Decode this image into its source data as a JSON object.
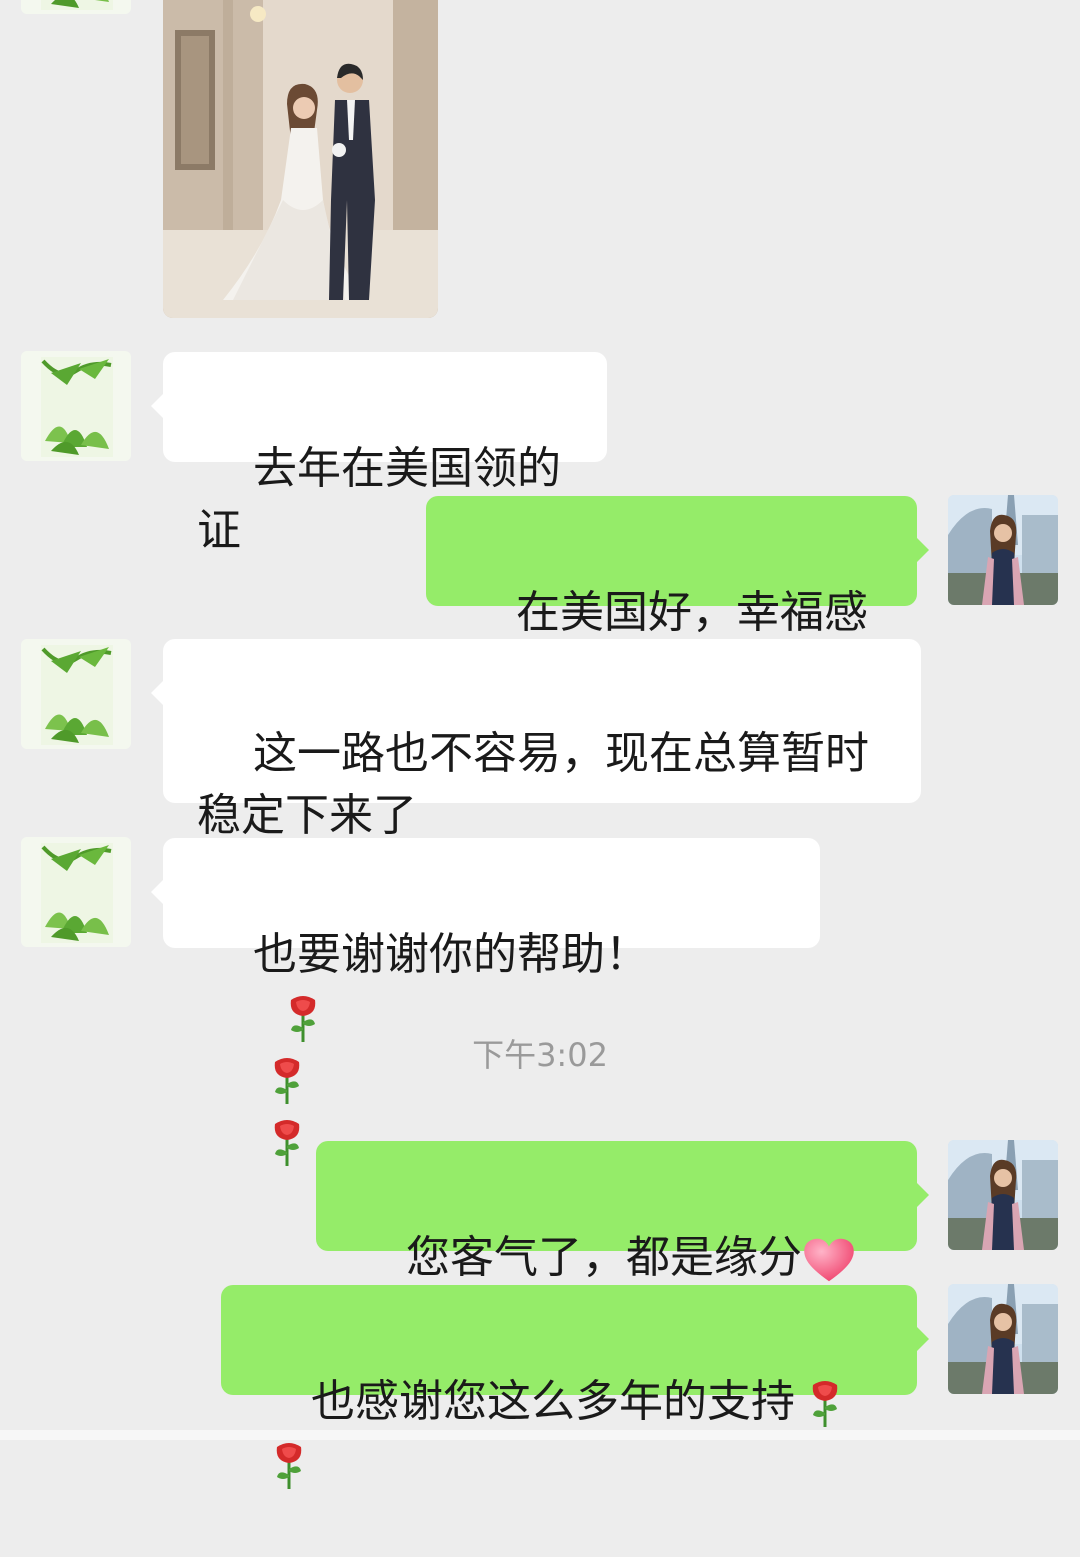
{
  "messages": [
    {
      "id": "m1",
      "direction": "in",
      "type": "image",
      "image_description_icon": "wedding-photo"
    },
    {
      "id": "m2",
      "direction": "in",
      "type": "text",
      "text": "去年在美国领的证"
    },
    {
      "id": "m3",
      "direction": "out",
      "type": "text",
      "text": "在美国好，幸福感强"
    },
    {
      "id": "m4",
      "direction": "in",
      "type": "text",
      "text": "这一路也不容易，现在总算暂时稳定下来了"
    },
    {
      "id": "m5",
      "direction": "in",
      "type": "text",
      "text": "也要谢谢你的帮助！",
      "emoji": [
        "rose",
        "rose",
        "rose"
      ]
    },
    {
      "id": "m6",
      "direction": "out",
      "type": "text",
      "text": "您客气了，都是缘分",
      "emoji": [
        "heart",
        "heart"
      ]
    },
    {
      "id": "m7",
      "direction": "out",
      "type": "text",
      "text": "也感谢您这么多年的支持",
      "emoji": [
        "rose",
        "rose"
      ]
    }
  ],
  "timestamp": "下午3:02",
  "colors": {
    "background": "#ededed",
    "incoming_bubble": "#ffffff",
    "outgoing_bubble": "#95ec69",
    "timestamp_text": "#9a9a9a"
  },
  "icons": {
    "contact_avatar": "green-tea-leaves-avatar",
    "self_avatar": "woman-city-avatar",
    "rose": "rose-emoji",
    "heart": "heart-emoji"
  }
}
